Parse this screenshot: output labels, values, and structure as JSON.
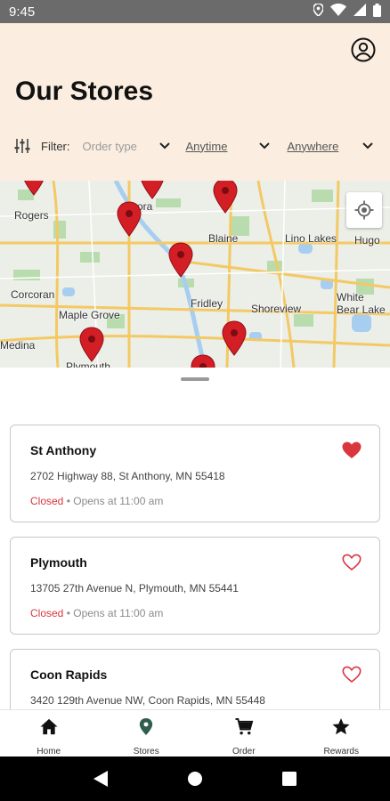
{
  "status_bar": {
    "time": "9:45"
  },
  "header": {
    "title": "Our Stores",
    "filter_label": "Filter:",
    "filters": [
      {
        "value": "Order type",
        "placeholder": true
      },
      {
        "value": "Anytime",
        "placeholder": false
      },
      {
        "value": "Anywhere",
        "placeholder": false
      }
    ]
  },
  "map": {
    "places": [
      "Rogers",
      "Blaine",
      "Lino Lakes",
      "Hugo",
      "Corcoran",
      "Maple Grove",
      "Fridley",
      "Shoreview",
      "White Bear Lake",
      "Medina",
      "Plymouth",
      "ora"
    ],
    "pin_color": "#d41e26"
  },
  "stores": [
    {
      "name": "St Anthony",
      "address": "2702 Highway 88, St Anthony, MN 55418",
      "closed": "Closed",
      "hours": "• Opens at 11:00 am",
      "favorite": true
    },
    {
      "name": "Plymouth",
      "address": "13705 27th Avenue N, Plymouth, MN 55441",
      "closed": "Closed",
      "hours": "• Opens at 11:00 am",
      "favorite": false
    },
    {
      "name": "Coon Rapids",
      "address": "3420 129th Avenue NW, Coon Rapids, MN 55448",
      "closed": "",
      "hours": "",
      "favorite": false
    }
  ],
  "bottom_nav": [
    {
      "label": "Home",
      "icon": "home-icon"
    },
    {
      "label": "Stores",
      "icon": "map-pin-icon",
      "active": true
    },
    {
      "label": "Order",
      "icon": "cart-icon"
    },
    {
      "label": "Rewards",
      "icon": "star-icon"
    }
  ],
  "colors": {
    "header_bg": "#fbeee0",
    "accent": "#d9363e",
    "active_nav": "#2f5d4f"
  }
}
